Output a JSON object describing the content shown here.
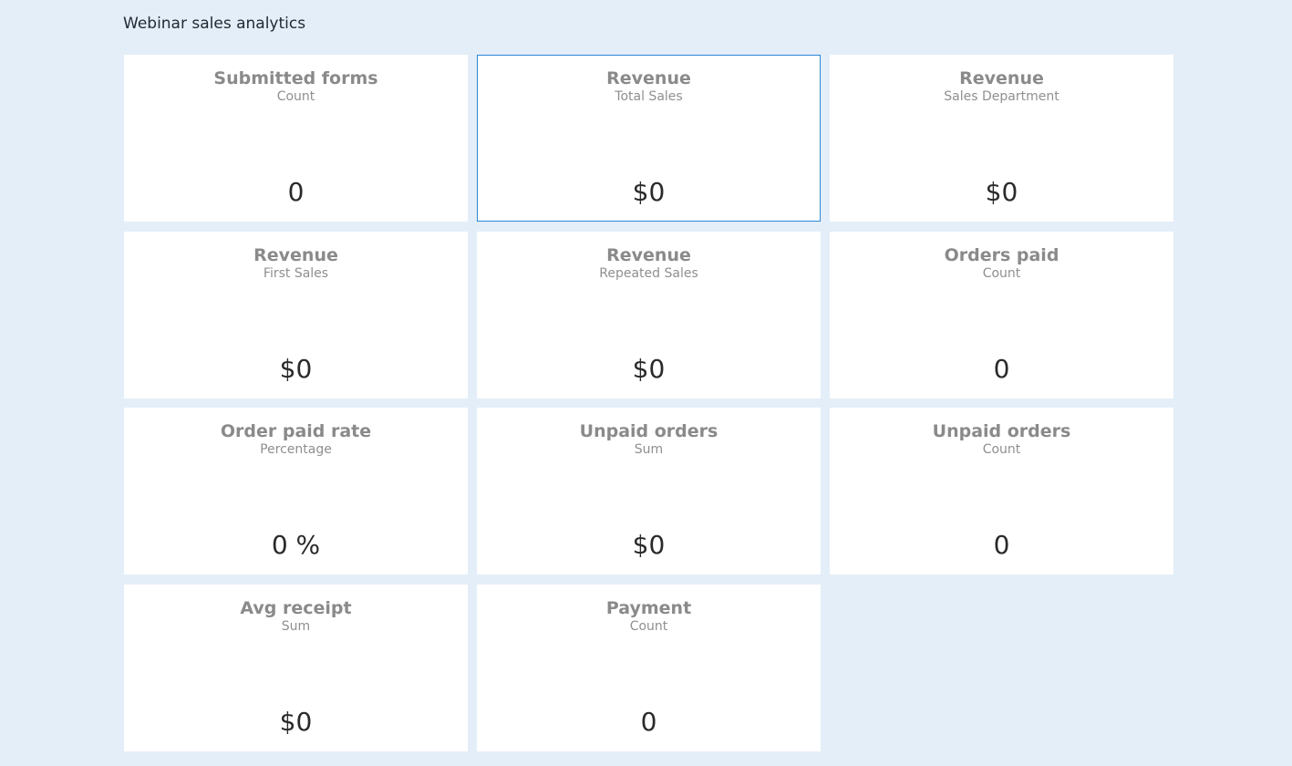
{
  "header": {
    "title": "Webinar sales analytics"
  },
  "cards": [
    {
      "title": "Submitted forms",
      "subtitle": "Count",
      "value": "0"
    },
    {
      "title": "Revenue",
      "subtitle": "Total Sales",
      "value": "$0"
    },
    {
      "title": "Revenue",
      "subtitle": "Sales Department",
      "value": "$0"
    },
    {
      "title": "Revenue",
      "subtitle": "First Sales",
      "value": "$0"
    },
    {
      "title": "Revenue",
      "subtitle": "Repeated Sales",
      "value": "$0"
    },
    {
      "title": "Orders paid",
      "subtitle": "Count",
      "value": "0"
    },
    {
      "title": "Order paid rate",
      "subtitle": "Percentage",
      "value": "0 %"
    },
    {
      "title": "Unpaid orders",
      "subtitle": "Sum",
      "value": "$0"
    },
    {
      "title": "Unpaid orders",
      "subtitle": "Count",
      "value": "0"
    },
    {
      "title": "Avg receipt",
      "subtitle": "Sum",
      "value": "$0"
    },
    {
      "title": "Payment",
      "subtitle": "Count",
      "value": "0"
    }
  ],
  "colors": {
    "background": "#e4eef8",
    "card": "#ffffff",
    "selected_border": "#2a86d6"
  }
}
